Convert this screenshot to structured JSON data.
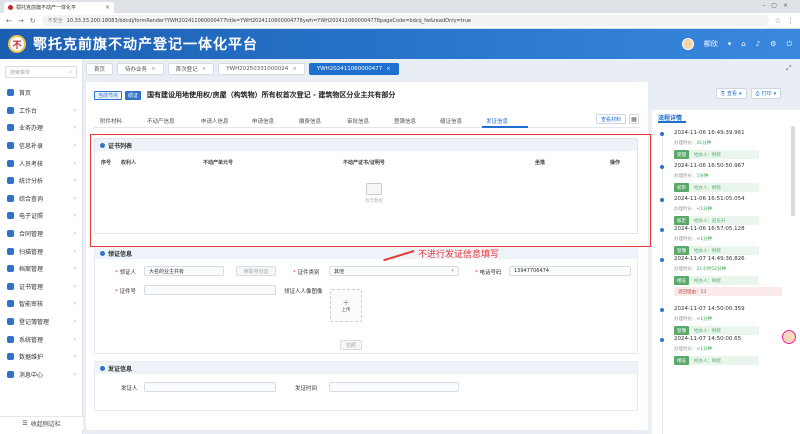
{
  "browser": {
    "tab_title": "鄂托克前旗不动产一体化平",
    "security_label": "不安全",
    "url": "10.33.33.200:18083/bdcdj/formRender?YWH202411060000477title=YWH2024110600004778ywh=YWH2024110600004778pageCode=bdcq_fw&readOnly=true"
  },
  "header": {
    "logo_text": "不",
    "title": "鄂托克前旗不动产登记一体化平台",
    "user_name": "柳欣"
  },
  "sidebar": {
    "search_placeholder": "搜索菜单",
    "items": [
      {
        "label": "首页",
        "arrow": ""
      },
      {
        "label": "工作台",
        "arrow": "›"
      },
      {
        "label": "业务办理",
        "arrow": "›"
      },
      {
        "label": "信息补录",
        "arrow": "›"
      },
      {
        "label": "人员考核",
        "arrow": "›"
      },
      {
        "label": "统计分析",
        "arrow": "›"
      },
      {
        "label": "综合查询",
        "arrow": "›"
      },
      {
        "label": "电子证照",
        "arrow": "›"
      },
      {
        "label": "合同管理",
        "arrow": "›"
      },
      {
        "label": "扫描管理",
        "arrow": "›"
      },
      {
        "label": "档案管理",
        "arrow": "›"
      },
      {
        "label": "证书管理",
        "arrow": "›"
      },
      {
        "label": "智能审核",
        "arrow": "›"
      },
      {
        "label": "登记簿管理",
        "arrow": "›"
      },
      {
        "label": "系统管理",
        "arrow": "›"
      },
      {
        "label": "数据维护",
        "arrow": "›"
      },
      {
        "label": "消息中心",
        "arrow": "›"
      }
    ],
    "collapse_label": "收起侧边栏"
  },
  "page_tabs": [
    {
      "label": "首页",
      "closable": false
    },
    {
      "label": "待办业务",
      "closable": true
    },
    {
      "label": "首次登记",
      "closable": true
    },
    {
      "label": "YWH20250331000024",
      "closable": true
    },
    {
      "label": "YWH202411060000477",
      "closable": true
    }
  ],
  "title_bar": {
    "badge1": "当前节点",
    "badge2": "缮证",
    "title": "国有建设用地使用权/房屋（构筑物）所有权首次登记 - 建筑物区分业主共有部分"
  },
  "sub_tabs": [
    "附件材料",
    "不动产信息",
    "申请人信息",
    "申请信息",
    "缴费信息",
    "审批信息",
    "登簿信息",
    "缮证信息",
    "发证信息"
  ],
  "sub_tab_active": "发证信息",
  "attach_button": "查看材料",
  "cert_list": {
    "title": "证书列表",
    "columns": [
      "序号",
      "权利人",
      "不动产单元号",
      "不动产证书/证明号",
      "坐落",
      "操作"
    ],
    "empty_text": "暂无数据"
  },
  "annotation": "不进行发证信息填写",
  "receiver": {
    "title": "领证信息",
    "receiver_label": "领证人",
    "receiver_value": "大名的业主共有",
    "read_card_button": "读取身份证",
    "id_type_label": "证件类别",
    "id_type_value": "其他",
    "phone_label": "电话号码",
    "phone_value": "13947706474",
    "id_no_label": "证件号",
    "photo_label": "领证人人像图像",
    "upload_label": "上传",
    "photo_button": "拍照"
  },
  "issue": {
    "title": "发证信息",
    "issuer_label": "发证人",
    "time_label": "发证时间"
  },
  "right_toolbar": {
    "scan_button": "查看",
    "print_button": "打印"
  },
  "flow": {
    "title": "流程详情",
    "items": [
      {
        "time": "2024-11-06 16:49:39.961",
        "duration": "41分钟",
        "node": "受理",
        "who": "经办人：柳欣",
        "reason": ""
      },
      {
        "time": "2024-11-06 16:50:50.967",
        "duration": "1分钟",
        "node": "初审",
        "who": "经办人：柳欣",
        "reason": ""
      },
      {
        "time": "2024-11-06 16:51:05.054",
        "duration": "<1分钟",
        "node": "核定",
        "who": "经办人：赵东升",
        "reason": ""
      },
      {
        "time": "2024-11-06 16:57:05.128",
        "duration": "<1分钟",
        "node": "登簿",
        "who": "经办人：柳欣",
        "reason": ""
      },
      {
        "time": "2024-11-07 14:49:36.826",
        "duration": "21小时52分钟",
        "node": "缮证",
        "who": "经办人：柳欣",
        "reason": "退回理由：23"
      },
      {
        "time": "2024-11-07 14:50:00.359",
        "duration": "<1分钟",
        "node": "登簿",
        "who": "经办人：柳欣",
        "reason": ""
      },
      {
        "time": "2024-11-07 14:50:00.65",
        "duration": "<1分钟",
        "node": "缮证",
        "who": "经办人：柳欣",
        "reason": ""
      }
    ],
    "duration_label": "办理时长："
  }
}
